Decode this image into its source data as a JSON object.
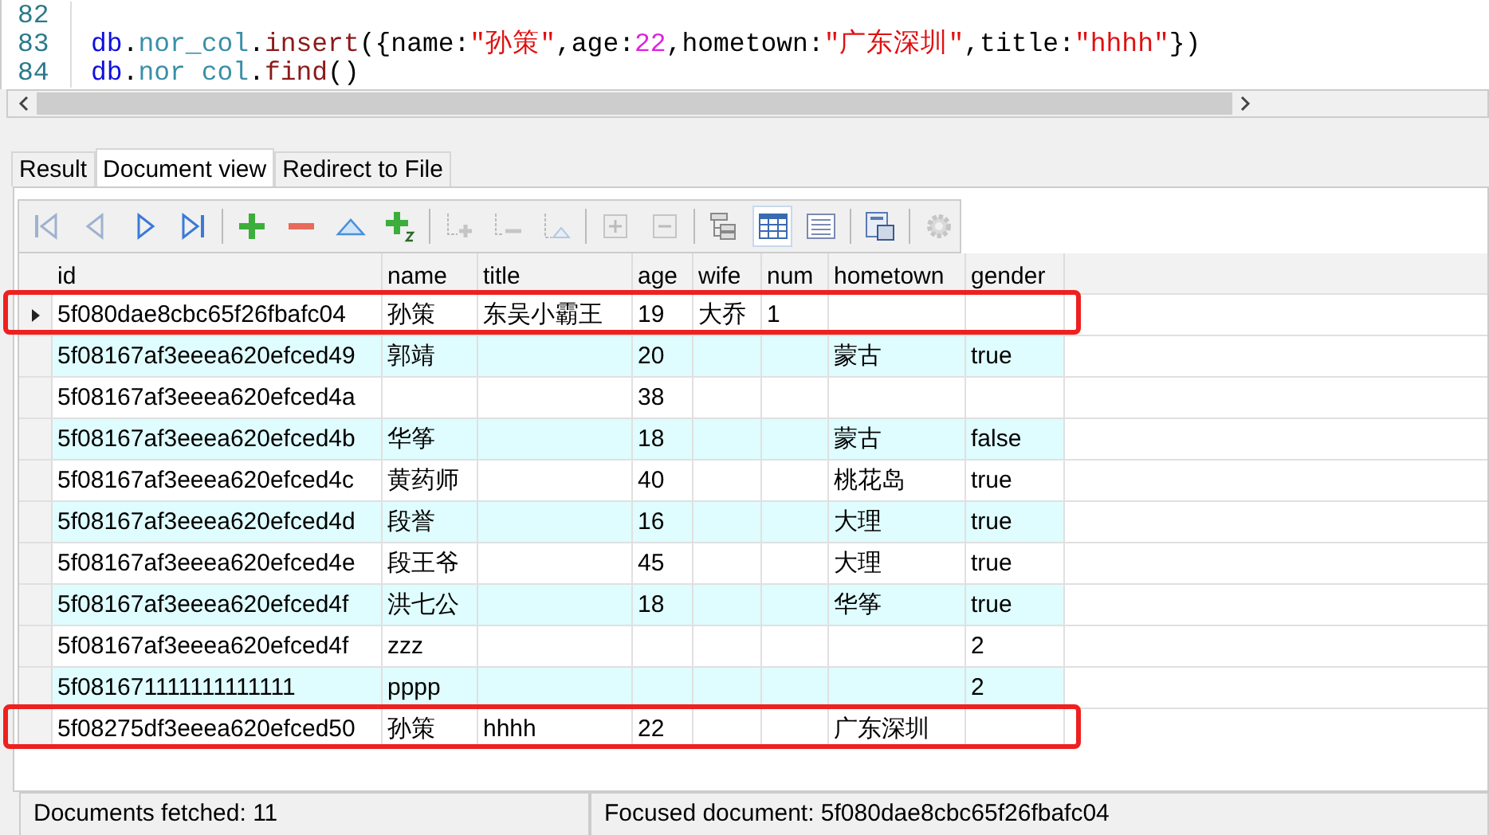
{
  "editor": {
    "lines": [
      {
        "number": "82"
      },
      {
        "number": "83",
        "tokens": [
          {
            "kind": "object",
            "text": "db"
          },
          {
            "kind": "punct",
            "text": "."
          },
          {
            "kind": "property",
            "text": "nor_col"
          },
          {
            "kind": "punct",
            "text": "."
          },
          {
            "kind": "method",
            "text": "insert"
          },
          {
            "kind": "punct",
            "text": "({name:"
          },
          {
            "kind": "string",
            "text": "\"孙策\""
          },
          {
            "kind": "punct",
            "text": ",age:"
          },
          {
            "kind": "number",
            "text": "22"
          },
          {
            "kind": "punct",
            "text": ",hometown:"
          },
          {
            "kind": "string",
            "text": "\"广东深圳\""
          },
          {
            "kind": "punct",
            "text": ",title:"
          },
          {
            "kind": "string",
            "text": "\"hhhh\""
          },
          {
            "kind": "punct",
            "text": "})"
          }
        ]
      },
      {
        "number": "84",
        "tokens": [
          {
            "kind": "object",
            "text": "db"
          },
          {
            "kind": "punct",
            "text": "."
          },
          {
            "kind": "property",
            "text": "nor col"
          },
          {
            "kind": "punct",
            "text": "."
          },
          {
            "kind": "method",
            "text": "find"
          },
          {
            "kind": "punct",
            "text": "()"
          }
        ]
      }
    ]
  },
  "tabs": [
    {
      "label": "Result",
      "selected": false
    },
    {
      "label": "Document view",
      "selected": true
    },
    {
      "label": "Redirect to File",
      "selected": false
    }
  ],
  "toolbar": [
    {
      "kind": "first",
      "disabled": true,
      "selected": false
    },
    {
      "kind": "prev",
      "disabled": true,
      "selected": false
    },
    {
      "kind": "next",
      "disabled": false,
      "selected": false
    },
    {
      "kind": "last",
      "disabled": false,
      "selected": false
    },
    {
      "kind": "sep"
    },
    {
      "kind": "add",
      "disabled": false,
      "selected": false
    },
    {
      "kind": "remove",
      "disabled": false,
      "selected": false
    },
    {
      "kind": "up",
      "disabled": false,
      "selected": false
    },
    {
      "kind": "add2",
      "disabled": false,
      "selected": false
    },
    {
      "kind": "sep"
    },
    {
      "kind": "tree-add",
      "disabled": true,
      "selected": false
    },
    {
      "kind": "tree-remove",
      "disabled": true,
      "selected": false
    },
    {
      "kind": "tree-up",
      "disabled": true,
      "selected": false
    },
    {
      "kind": "sep"
    },
    {
      "kind": "expand",
      "disabled": true,
      "selected": false
    },
    {
      "kind": "collapse",
      "disabled": true,
      "selected": false
    },
    {
      "kind": "sep"
    },
    {
      "kind": "tree-view",
      "disabled": false,
      "selected": false
    },
    {
      "kind": "table-view",
      "disabled": false,
      "selected": true
    },
    {
      "kind": "text-view",
      "disabled": false,
      "selected": false
    },
    {
      "kind": "sep"
    },
    {
      "kind": "export",
      "disabled": false,
      "selected": false
    },
    {
      "kind": "sep"
    },
    {
      "kind": "settings",
      "disabled": true,
      "selected": false
    }
  ],
  "table": {
    "columns": [
      "id",
      "name",
      "title",
      "age",
      "wife",
      "num",
      "hometown",
      "gender"
    ],
    "rows": [
      {
        "current": true,
        "highlighted": true,
        "cells": [
          "5f080dae8cbc65f26fbafc04",
          "孙策",
          "东吴小霸王",
          "19",
          "大乔",
          "1",
          "",
          ""
        ]
      },
      {
        "current": false,
        "highlighted": false,
        "cells": [
          "5f08167af3eeea620efced49",
          "郭靖",
          "",
          "20",
          "",
          "",
          "蒙古",
          "true"
        ]
      },
      {
        "current": false,
        "highlighted": false,
        "cells": [
          "5f08167af3eeea620efced4a",
          "",
          "",
          "38",
          "",
          "",
          "",
          ""
        ]
      },
      {
        "current": false,
        "highlighted": false,
        "cells": [
          "5f08167af3eeea620efced4b",
          "华筝",
          "",
          "18",
          "",
          "",
          "蒙古",
          "false"
        ]
      },
      {
        "current": false,
        "highlighted": false,
        "cells": [
          "5f08167af3eeea620efced4c",
          "黄药师",
          "",
          "40",
          "",
          "",
          "桃花岛",
          "true"
        ]
      },
      {
        "current": false,
        "highlighted": false,
        "cells": [
          "5f08167af3eeea620efced4d",
          "段誉",
          "",
          "16",
          "",
          "",
          "大理",
          "true"
        ]
      },
      {
        "current": false,
        "highlighted": false,
        "cells": [
          "5f08167af3eeea620efced4e",
          "段王爷",
          "",
          "45",
          "",
          "",
          "大理",
          "true"
        ]
      },
      {
        "current": false,
        "highlighted": false,
        "cells": [
          "5f08167af3eeea620efced4f",
          "洪七公",
          "",
          "18",
          "",
          "",
          "华筝",
          "true"
        ]
      },
      {
        "current": false,
        "highlighted": false,
        "cells": [
          "5f08167af3eeea620efced4f",
          "zzz",
          "",
          "",
          "",
          "",
          "",
          "2"
        ]
      },
      {
        "current": false,
        "highlighted": false,
        "cells": [
          "5f081671111111111111",
          "pppp",
          "",
          "",
          "",
          "",
          "",
          "2"
        ]
      },
      {
        "current": false,
        "highlighted": true,
        "cells": [
          "5f08275df3eeea620efced50",
          "孙策",
          "hhhh",
          "22",
          "",
          "",
          "广东深圳",
          ""
        ]
      }
    ]
  },
  "status_bar": [
    "Documents fetched: 11",
    "Focused document: 5f080dae8cbc65f26fbafc04"
  ]
}
